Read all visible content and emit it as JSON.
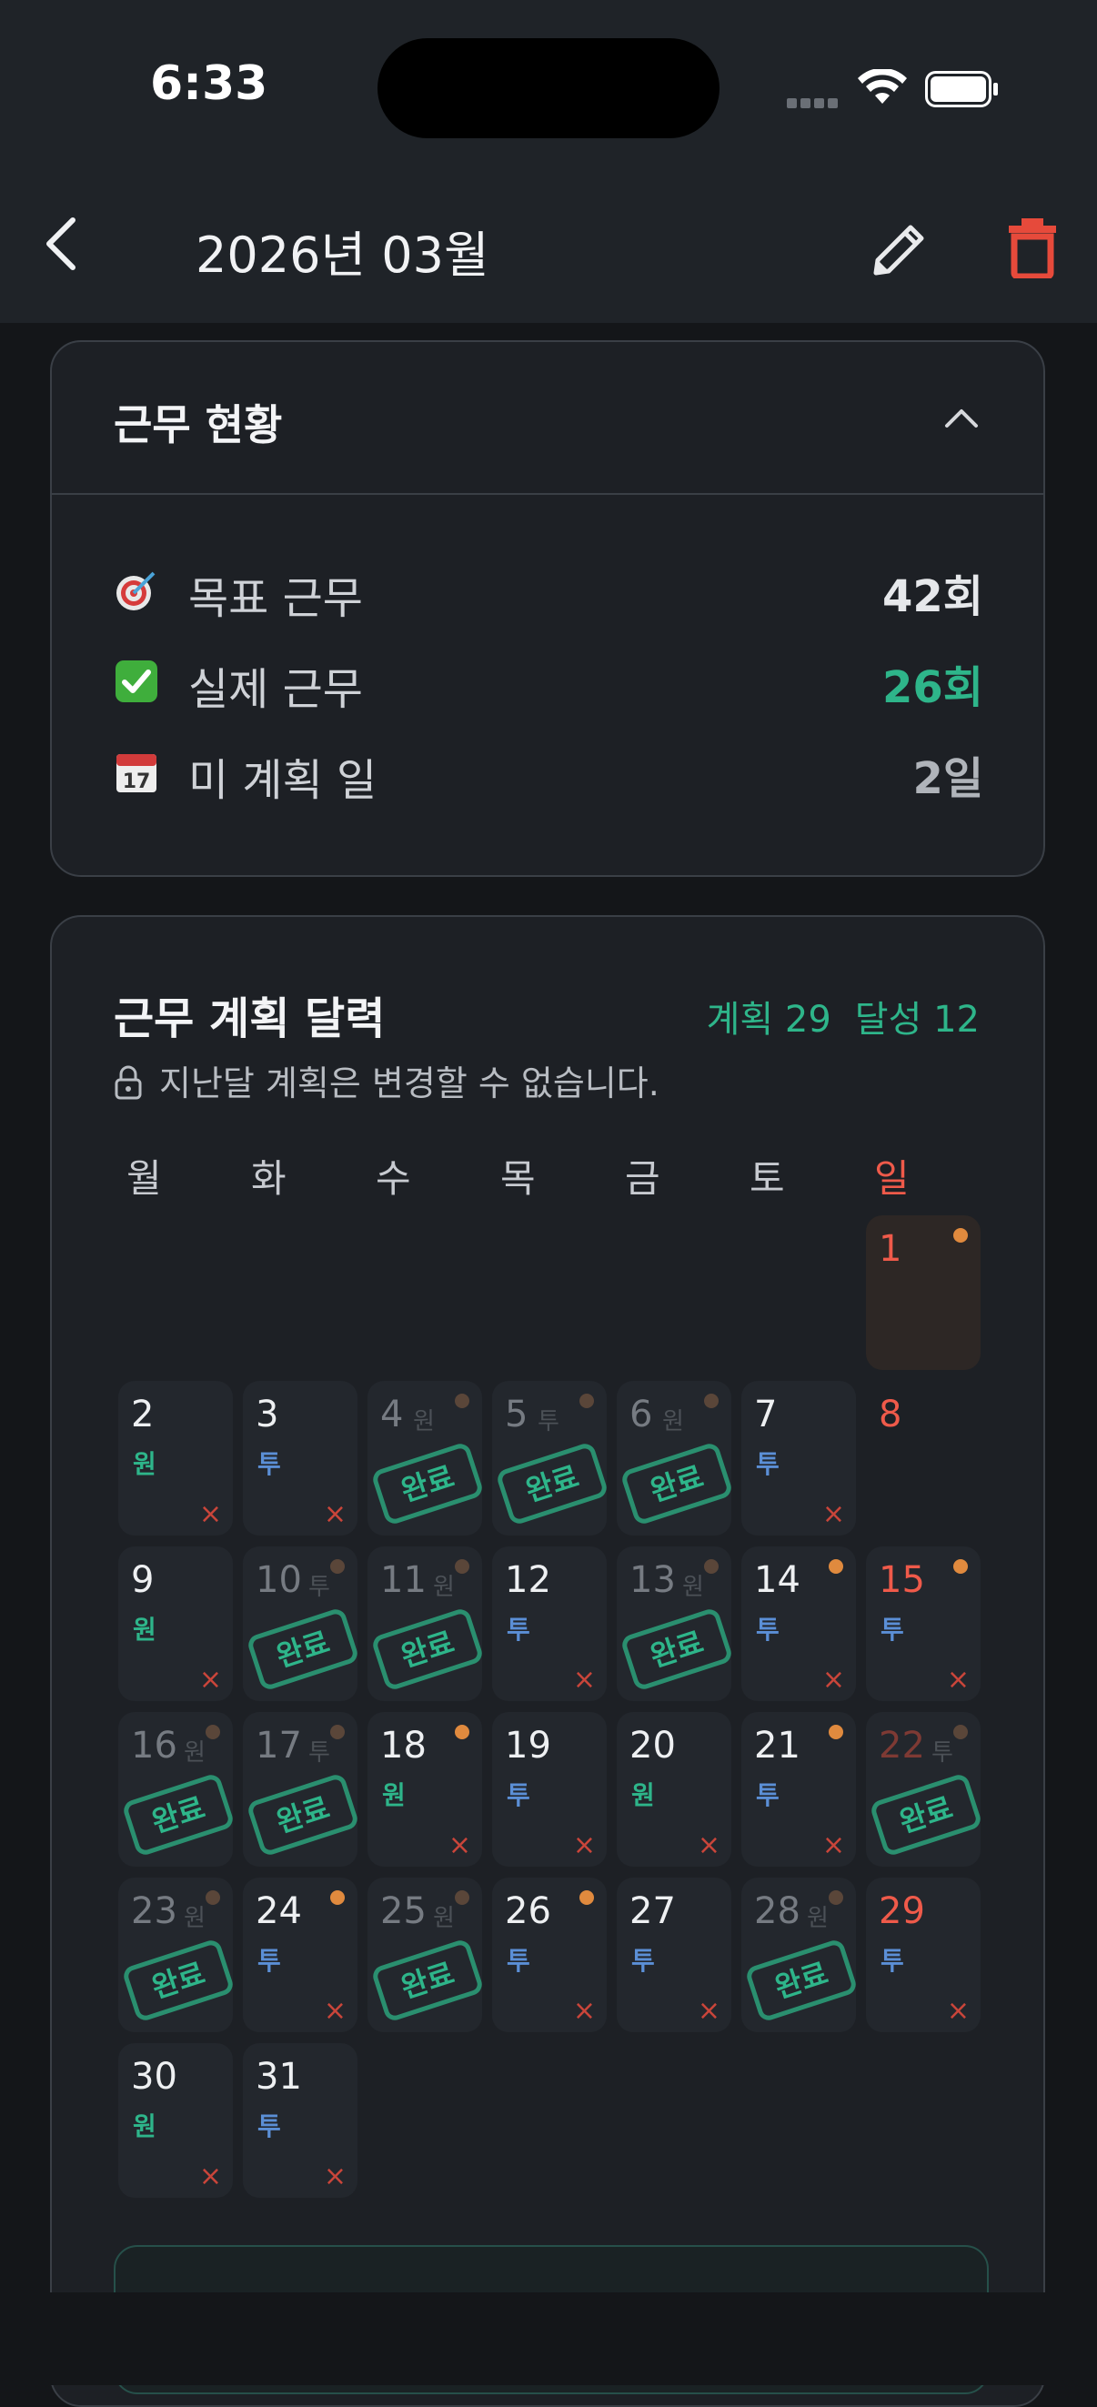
{
  "status_bar": {
    "time": "6:33"
  },
  "header": {
    "title": "2026년 03월"
  },
  "colors": {
    "accent": "#2eb58a",
    "sunday": "#ef5a4a",
    "tu": "#5b8fd6",
    "delete": "#e64a3b",
    "dot": "#e08a3e"
  },
  "work_status": {
    "title": "근무 현황",
    "rows": [
      {
        "icon": "target-icon",
        "label": "목표 근무",
        "value": "42회",
        "color": "#e6e8eb"
      },
      {
        "icon": "check-icon",
        "label": "실제 근무",
        "value": "26회",
        "color": "#2eb58a"
      },
      {
        "icon": "calendar-icon",
        "label": "미 계획 일",
        "value": "2일",
        "color": "#b0b4ba"
      }
    ]
  },
  "calendar": {
    "title": "근무 계획 달력",
    "summary_plan": "계획 29",
    "summary_done": "달성 12",
    "lock_note": "지난달 계획은 변경할 수 없습니다.",
    "weekdays": [
      "월",
      "화",
      "수",
      "목",
      "금",
      "토",
      "일"
    ],
    "done_label": "완료",
    "remove_label": "×",
    "days": [
      {
        "d": "1",
        "col": 6,
        "row": 0,
        "type": "plain",
        "dot": true,
        "sun": true,
        "first": true
      },
      {
        "d": "2",
        "col": 0,
        "row": 1,
        "type": "plan",
        "sub": "원",
        "x": true
      },
      {
        "d": "3",
        "col": 1,
        "row": 1,
        "type": "plan",
        "sub": "투",
        "x": true
      },
      {
        "d": "4",
        "col": 2,
        "row": 1,
        "type": "done",
        "sub": "원",
        "dot": true
      },
      {
        "d": "5",
        "col": 3,
        "row": 1,
        "type": "done",
        "sub": "투",
        "dot": true
      },
      {
        "d": "6",
        "col": 4,
        "row": 1,
        "type": "done",
        "sub": "원",
        "dot": true
      },
      {
        "d": "7",
        "col": 5,
        "row": 1,
        "type": "plan",
        "sub": "투",
        "x": true
      },
      {
        "d": "8",
        "col": 6,
        "row": 1,
        "type": "empty",
        "sun": true
      },
      {
        "d": "9",
        "col": 0,
        "row": 2,
        "type": "plan",
        "sub": "원",
        "x": true
      },
      {
        "d": "10",
        "col": 1,
        "row": 2,
        "type": "done",
        "sub": "투",
        "dot": true
      },
      {
        "d": "11",
        "col": 2,
        "row": 2,
        "type": "done",
        "sub": "원",
        "dot": true
      },
      {
        "d": "12",
        "col": 3,
        "row": 2,
        "type": "plan",
        "sub": "투",
        "x": true
      },
      {
        "d": "13",
        "col": 4,
        "row": 2,
        "type": "done",
        "sub": "원",
        "dot": true
      },
      {
        "d": "14",
        "col": 5,
        "row": 2,
        "type": "plan",
        "sub": "투",
        "x": true,
        "dot": true
      },
      {
        "d": "15",
        "col": 6,
        "row": 2,
        "type": "plan",
        "sub": "투",
        "x": true,
        "dot": true,
        "sun": true
      },
      {
        "d": "16",
        "col": 0,
        "row": 3,
        "type": "done",
        "sub": "원",
        "dot": true
      },
      {
        "d": "17",
        "col": 1,
        "row": 3,
        "type": "done",
        "sub": "투",
        "dot": true
      },
      {
        "d": "18",
        "col": 2,
        "row": 3,
        "type": "plan",
        "sub": "원",
        "x": true,
        "dot": true
      },
      {
        "d": "19",
        "col": 3,
        "row": 3,
        "type": "plan",
        "sub": "투",
        "x": true
      },
      {
        "d": "20",
        "col": 4,
        "row": 3,
        "type": "plan",
        "sub": "원",
        "x": true
      },
      {
        "d": "21",
        "col": 5,
        "row": 3,
        "type": "plan",
        "sub": "투",
        "x": true,
        "dot": true
      },
      {
        "d": "22",
        "col": 6,
        "row": 3,
        "type": "done",
        "sub": "투",
        "dot": true,
        "sun": true
      },
      {
        "d": "23",
        "col": 0,
        "row": 4,
        "type": "done",
        "sub": "원",
        "dot": true
      },
      {
        "d": "24",
        "col": 1,
        "row": 4,
        "type": "plan",
        "sub": "투",
        "x": true,
        "dot": true
      },
      {
        "d": "25",
        "col": 2,
        "row": 4,
        "type": "done",
        "sub": "원",
        "dot": true
      },
      {
        "d": "26",
        "col": 3,
        "row": 4,
        "type": "plan",
        "sub": "투",
        "x": true,
        "dot": true
      },
      {
        "d": "27",
        "col": 4,
        "row": 4,
        "type": "plan",
        "sub": "투",
        "x": true
      },
      {
        "d": "28",
        "col": 5,
        "row": 4,
        "type": "done",
        "sub": "원",
        "dot": true
      },
      {
        "d": "29",
        "col": 6,
        "row": 4,
        "type": "plan",
        "sub": "투",
        "x": true,
        "sun": true
      },
      {
        "d": "30",
        "col": 0,
        "row": 5,
        "type": "plan",
        "sub": "원",
        "x": true
      },
      {
        "d": "31",
        "col": 1,
        "row": 5,
        "type": "plan",
        "sub": "투",
        "x": true
      }
    ]
  }
}
